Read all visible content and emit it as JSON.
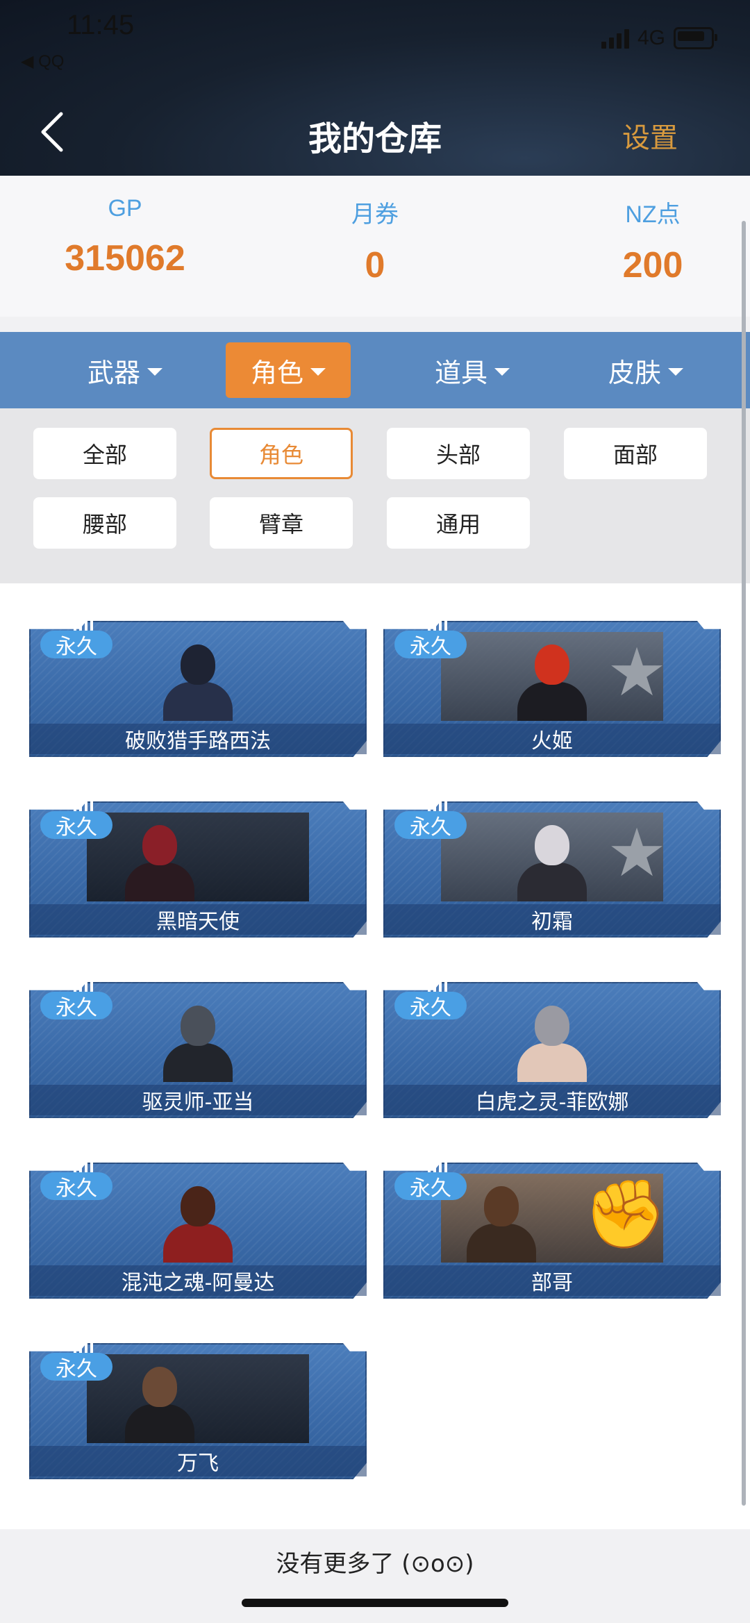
{
  "status": {
    "time": "11:45",
    "back_app": "◀ QQ",
    "network": "4G"
  },
  "nav": {
    "title": "我的仓库",
    "settings": "设置"
  },
  "currency": [
    {
      "label": "GP",
      "value": "315062"
    },
    {
      "label": "月券",
      "value": "0"
    },
    {
      "label": "NZ点",
      "value": "200"
    }
  ],
  "tabs": [
    {
      "label": "武器",
      "active": false
    },
    {
      "label": "角色",
      "active": true
    },
    {
      "label": "道具",
      "active": false
    },
    {
      "label": "皮肤",
      "active": false
    }
  ],
  "filters": [
    {
      "label": "全部",
      "active": false
    },
    {
      "label": "角色",
      "active": true
    },
    {
      "label": "头部",
      "active": false
    },
    {
      "label": "面部",
      "active": false
    },
    {
      "label": "腰部",
      "active": false
    },
    {
      "label": "臂章",
      "active": false
    },
    {
      "label": "通用",
      "active": false
    }
  ],
  "items": [
    {
      "badge": "永久",
      "name": "破败猎手路西法"
    },
    {
      "badge": "永久",
      "name": "火姬"
    },
    {
      "badge": "永久",
      "name": "黑暗天使"
    },
    {
      "badge": "永久",
      "name": "初霜"
    },
    {
      "badge": "永久",
      "name": "驱灵师-亚当"
    },
    {
      "badge": "永久",
      "name": "白虎之灵-菲欧娜"
    },
    {
      "badge": "永久",
      "name": "混沌之魂-阿曼达"
    },
    {
      "badge": "永久",
      "name": "部哥"
    },
    {
      "badge": "永久",
      "name": "万飞"
    }
  ],
  "footer": {
    "no_more": "没有更多了 (⊙o⊙)"
  },
  "colors": {
    "accent": "#ec8a35",
    "tab_bar": "#5b8ac1",
    "currency_value": "#e07a2b",
    "currency_label": "#4e9fe0",
    "badge": "#4a9fe4"
  }
}
